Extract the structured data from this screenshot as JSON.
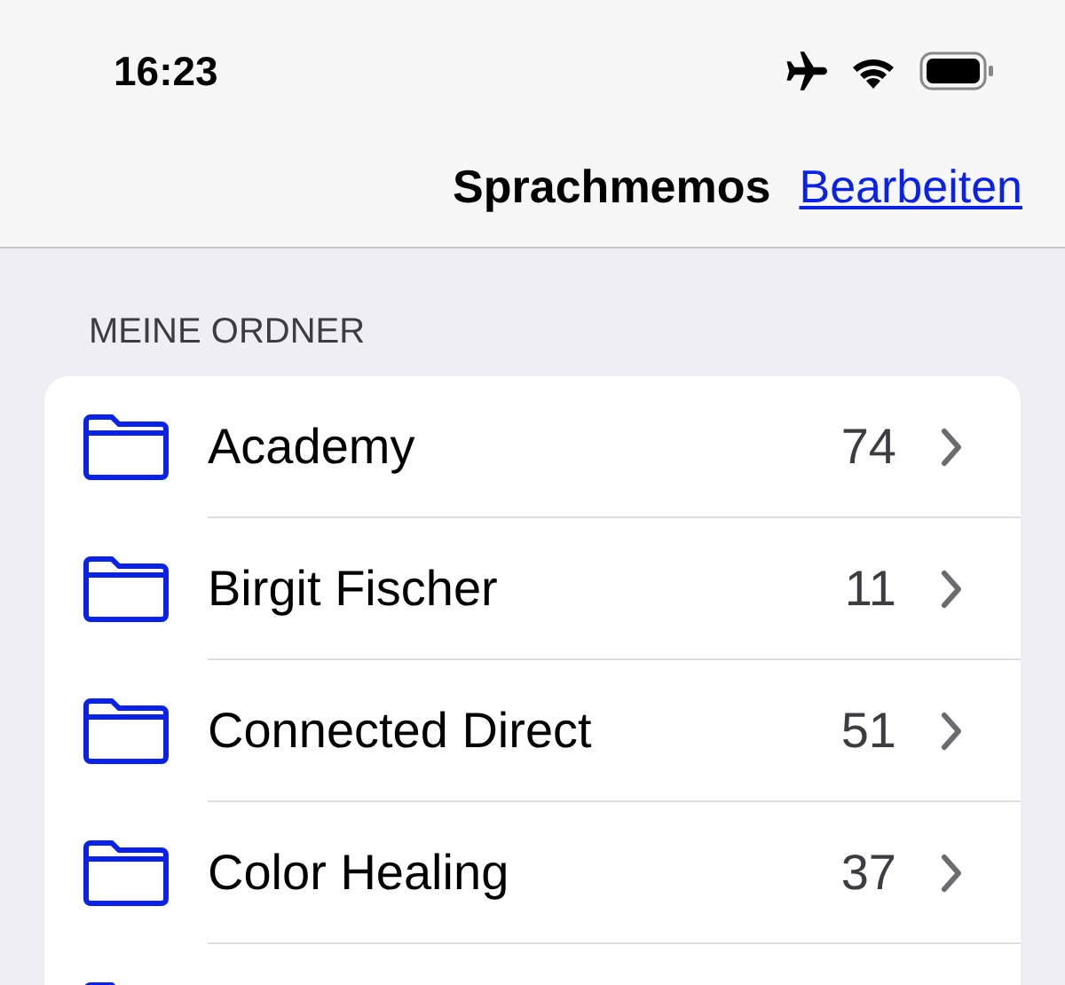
{
  "status_bar": {
    "time": "16:23"
  },
  "nav_bar": {
    "title": "Sprachmemos",
    "edit_link": "Bearbeiten"
  },
  "section": {
    "header": "MEINE ORDNER"
  },
  "folders": [
    {
      "name": "Academy",
      "count": "74"
    },
    {
      "name": "Birgit Fischer",
      "count": "11"
    },
    {
      "name": "Connected Direct",
      "count": "51"
    },
    {
      "name": "Color Healing",
      "count": "37"
    }
  ]
}
